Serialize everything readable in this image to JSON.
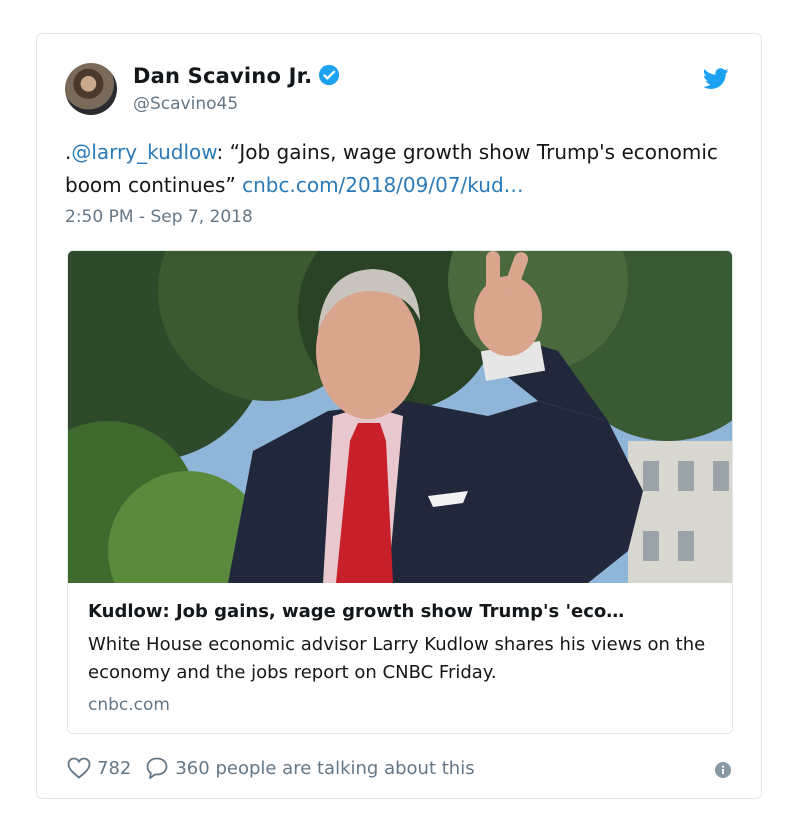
{
  "author": {
    "name": "Dan Scavino Jr.",
    "handle": "@Scavino45",
    "verified_icon": "verified-badge-icon",
    "avatar": "profile-photo"
  },
  "tweet": {
    "prefix": ".",
    "mention": "@larry_kudlow",
    "text": ": “Job gains, wage growth show Trump's economic boom continues” ",
    "link": "cnbc.com/2018/09/07/kud…",
    "timestamp": "2:50 PM - Sep 7, 2018"
  },
  "card": {
    "title": "Kudlow: Job gains, wage growth show Trump's 'eco…",
    "description": "White House economic advisor Larry Kudlow shares his views on the economy and the jobs report on CNBC Friday.",
    "domain": "cnbc.com"
  },
  "actions": {
    "like_icon": "heart-icon",
    "likes": "782",
    "reply_icon": "speech-bubble-icon",
    "talking": "360 people are talking about this",
    "info_icon": "info-icon"
  },
  "colors": {
    "link": "#2b7bb9",
    "twitter_blue": "#1da1f2",
    "secondary_text": "#657786",
    "border": "#e1e8ed"
  }
}
